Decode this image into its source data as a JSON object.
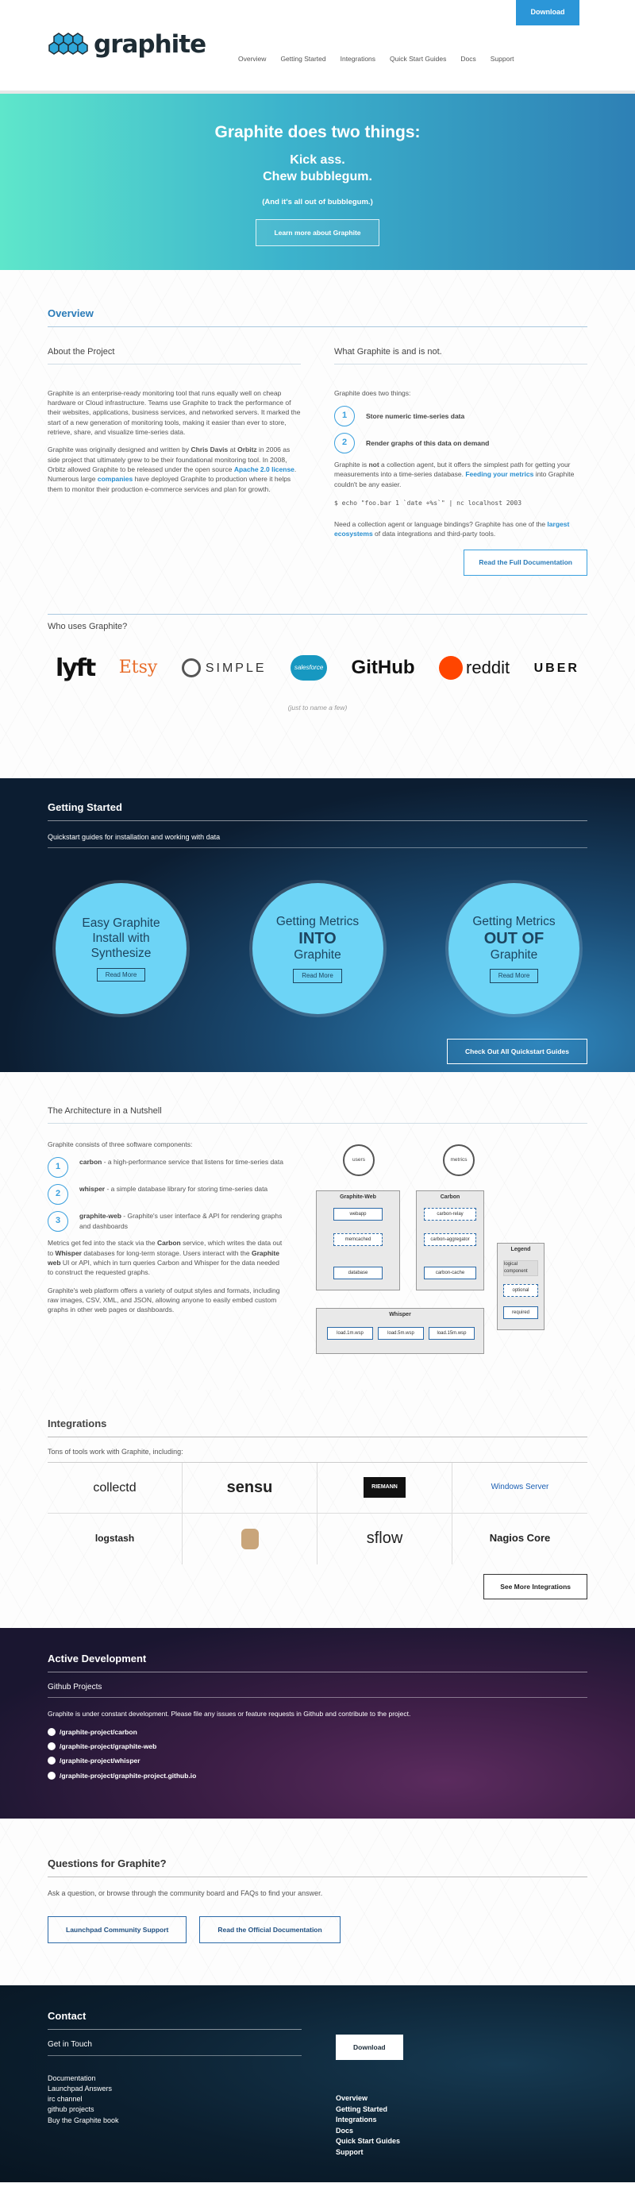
{
  "header": {
    "logo_text": "graphite",
    "nav": [
      "Overview",
      "Getting Started",
      "Integrations",
      "Quick Start Guides",
      "Docs",
      "Support"
    ],
    "download_label": "Download"
  },
  "hero": {
    "title": "Graphite does two things:",
    "line1": "Kick ass.",
    "line2": "Chew bubblegum.",
    "line3": "(And it's all out of bubblegum.)",
    "button": "Learn more about Graphite"
  },
  "overview": {
    "title": "Overview",
    "about_title": "About the Project",
    "about_p1": "Graphite is an enterprise-ready monitoring tool that runs equally well on cheap hardware or Cloud infrastructure. Teams use Graphite to track the performance of their websites, applications, business services, and networked servers. It marked the start of a new generation of monitoring tools, making it easier than ever to store, retrieve, share, and visualize time-series data.",
    "about_p2_a": "Graphite was originally designed and written by ",
    "about_p2_b": "Chris Davis",
    "about_p2_c": " at ",
    "about_p2_d": "Orbitz",
    "about_p2_e": " in 2006 as side project that ultimately grew to be their foundational monitoring tool. In 2008, Orbitz allowed Graphite to be released under the open source ",
    "about_p2_f": "Apache 2.0 license",
    "about_p2_g": ". Numerous large ",
    "about_p2_h": "companies",
    "about_p2_i": " have deployed Graphite to production where it helps them to monitor their production e-commerce services and plan for growth.",
    "what_title": "What Graphite is and is not.",
    "what_intro": "Graphite does two things:",
    "steps": [
      "Store numeric time-series data",
      "Render graphs of this data on demand"
    ],
    "not_a": "Graphite is ",
    "not_b": "not",
    "not_c": " a collection agent, but it offers the simplest path for getting your measurements into a time-series database. ",
    "not_d": "Feeding your metrics",
    "not_e": " into Graphite couldn't be any easier.",
    "code": "$ echo \"foo.bar 1 `date +%s`\" | nc localhost 2003",
    "need_a": "Need a collection agent or language bindings? Graphite has one of the ",
    "need_b": "largest ecosystems",
    "need_c": " of data integrations and third-party tools.",
    "docs_button": "Read the Full Documentation",
    "who_title": "Who uses Graphite?",
    "logos": [
      "lyft",
      "Etsy",
      "SIMPLE",
      "salesforce",
      "GitHub",
      "reddit",
      "UBER"
    ],
    "just_name": "(just to name a few)"
  },
  "getting_started": {
    "title": "Getting Started",
    "subtitle": "Quickstart guides for installation and working with data",
    "cards": [
      {
        "a": "Easy Graphite",
        "b": "Install with",
        "c": "Synthesize",
        "bold": "none",
        "more": "Read More"
      },
      {
        "a": "Getting Metrics",
        "b": "INTO",
        "c": "Graphite",
        "bold": "b",
        "more": "Read More"
      },
      {
        "a": "Getting Metrics",
        "b": "OUT OF",
        "c": "Graphite",
        "bold": "b",
        "more": "Read More"
      }
    ],
    "button": "Check Out All Quickstart Guides"
  },
  "architecture": {
    "title": "The Architecture in a Nutshell",
    "intro": "Graphite consists of three software components:",
    "components": [
      {
        "name": "carbon",
        "desc": " - a high-performance service that listens for time-series data"
      },
      {
        "name": "whisper",
        "desc": " - a simple database library for storing time-series data"
      },
      {
        "name": "graphite-web",
        "desc": " - Graphite's user interface & API for rendering graphs and dashboards"
      }
    ],
    "flow_a": "Metrics get fed into the stack via the ",
    "flow_b": "Carbon",
    "flow_c": " service, which writes the data out to ",
    "flow_d": "Whisper",
    "flow_e": " databases for long-term storage. Users interact with the ",
    "flow_f": "Graphite web",
    "flow_g": " UI or API, which in turn queries Carbon and Whisper for the data needed to construct the requested graphs.",
    "web_p": "Graphite's web platform offers a variety of output styles and formats, including raw images, CSV, XML, and JSON, allowing anyone to easily embed custom graphs in other web pages or dashboards.",
    "diagram": {
      "users": "users",
      "metrics": "metrics",
      "gw": "Graphite-Web",
      "webapp": "webapp",
      "memcached": "memcached",
      "database": "database",
      "carbon": "Carbon",
      "relay": "carbon-relay",
      "aggregator": "carbon-aggregator",
      "cache": "carbon-cache",
      "whisper": "Whisper",
      "files": [
        "load.1m.wsp",
        "load.5m.wsp",
        "load.15m.wsp"
      ],
      "legend": "Legend",
      "legend_items": [
        "logical component",
        "optional",
        "required"
      ]
    }
  },
  "integrations": {
    "title": "Integrations",
    "subtitle": "Tons of tools work with Graphite, including:",
    "tools": [
      "collectd",
      "sensu",
      "RIEMANN",
      "Windows Server",
      "logstash",
      "",
      "sflow",
      "Nagios Core"
    ],
    "button": "See More Integrations"
  },
  "dev": {
    "title": "Active Development",
    "subtitle": "Github Projects",
    "text": "Graphite is under constant development. Please file any issues or feature requests in Github and contribute to the project.",
    "repos": [
      "/graphite-project/carbon",
      "/graphite-project/graphite-web",
      "/graphite-project/whisper",
      "/graphite-project/graphite-project.github.io"
    ]
  },
  "questions": {
    "title": "Questions for Graphite?",
    "text": "Ask a question, or browse through the community board and FAQs to find your answer.",
    "btn1": "Launchpad Community Support",
    "btn2": "Read the Official Documentation"
  },
  "contact": {
    "title": "Contact",
    "subtitle": "Get in Touch",
    "links": [
      "Documentation",
      "Launchpad Answers",
      "irc channel",
      "github projects",
      "Buy the Graphite book"
    ],
    "download": "Download",
    "nav": [
      "Overview",
      "Getting Started",
      "Integrations",
      "Docs",
      "Quick Start Guides",
      "Support"
    ]
  },
  "colors": {
    "accent": "#2b96d8",
    "hero_start": "#5ee6cb",
    "hero_end": "#2e80b5"
  }
}
